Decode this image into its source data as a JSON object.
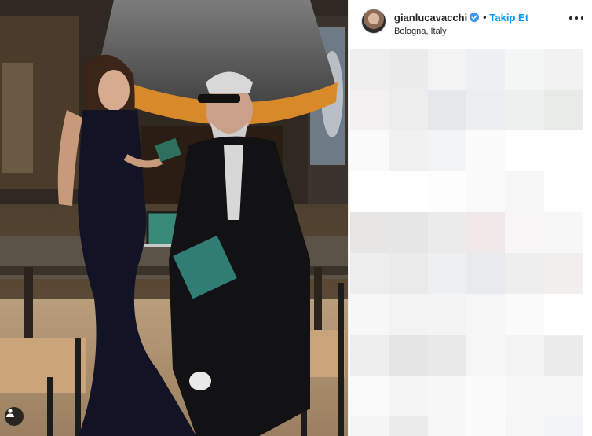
{
  "post": {
    "username": "gianlucavacchi",
    "verified": true,
    "separator": "•",
    "follow_label": "Takip Et",
    "location": "Bologna, Italy"
  },
  "icons": {
    "verified": "verified-badge-icon",
    "more": "more-options-icon",
    "user_tag": "user-tag-icon"
  },
  "colors": {
    "link_blue": "#0095f6",
    "text_dark": "#262626"
  },
  "pixel_tiles": [
    "#f0efef",
    "#ececec",
    "#f3f3f4",
    "#eef1f3",
    "#f4f5f5",
    "#f2f2f2",
    "#f3f1f1",
    "#ededee",
    "#e5e7ea",
    "#eceef0",
    "#eef0f0",
    "#e7ece7",
    "#fafafa",
    "#f1f1f1",
    "#f3f4f5",
    "#fbfbfb",
    "#ffffff",
    "#ffffff",
    "#ffffff",
    "#ffffff",
    "#fdfdfd",
    "#fafafa",
    "#f6f6f6",
    "#ffffff",
    "#e8e6e5",
    "#e6e6e6",
    "#ebebeb",
    "#efe7e8",
    "#f7f5f5",
    "#f7f7f7",
    "#ededed",
    "#eaeaeb",
    "#eeeff0",
    "#e9eaec",
    "#eeeeee",
    "#f1efed",
    "#f7f7f7",
    "#f3f3f3",
    "#f4f4f4",
    "#f6f6f6",
    "#fafafa",
    "#ffffff",
    "#eeeeee",
    "#e5e5e5",
    "#e9e9e9",
    "#f6f6f6",
    "#f3f3f3",
    "#ececec",
    "#f9f9f9",
    "#f5f5f5",
    "#f7f7f7",
    "#fbfbfb",
    "#f7f7f7",
    "#f6f6f6",
    "#f5f5f5",
    "#ececec",
    "#f7f7f7",
    "#fbfbfb",
    "#f6f6f6",
    "#f3f4f5"
  ]
}
